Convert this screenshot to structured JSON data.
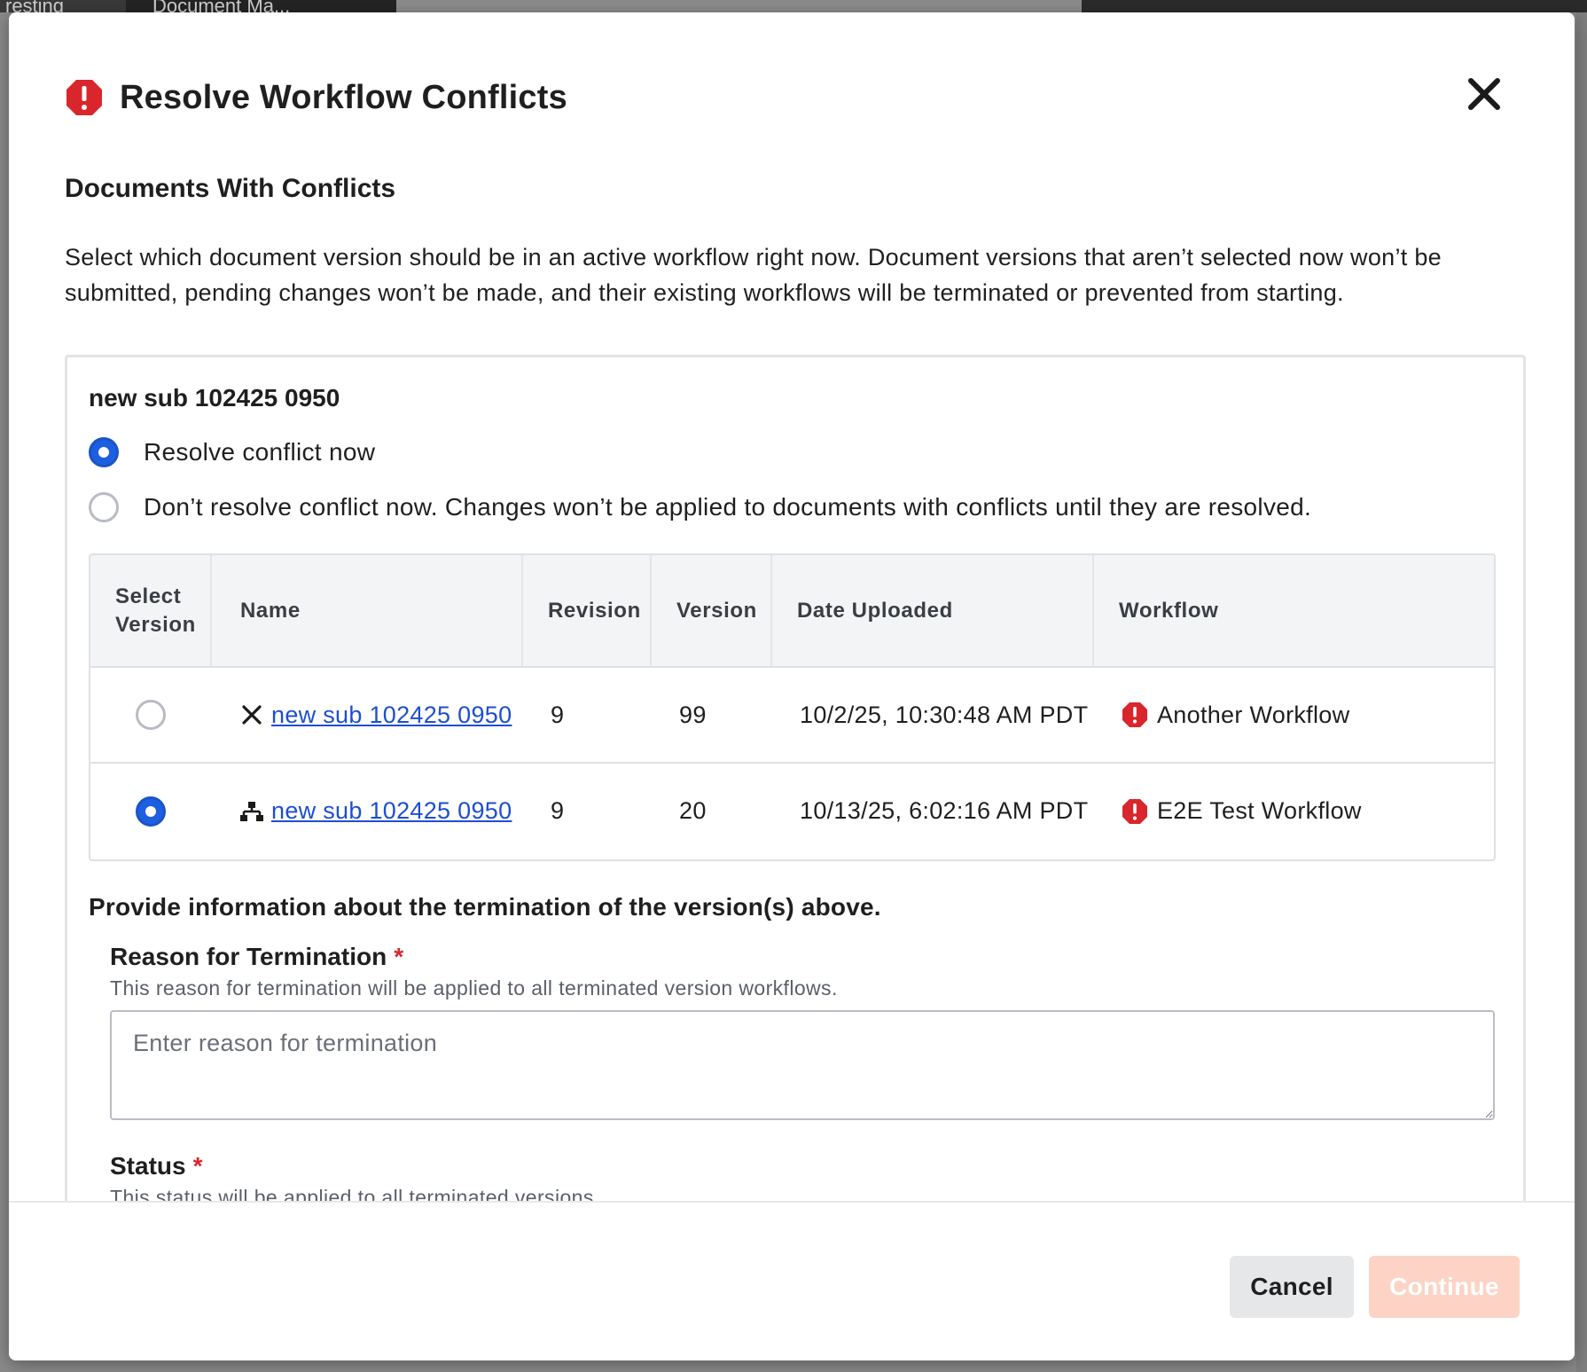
{
  "background": {
    "tabs": [
      "resting",
      "Document Ma..."
    ]
  },
  "modal": {
    "title": "Resolve Workflow Conflicts",
    "section_heading": "Documents With Conflicts",
    "description": "Select which document version should be in an active workflow right now. Document versions that aren’t selected now won’t be submitted, pending changes won’t be made, and their existing workflows will be terminated or prevented from starting.",
    "document": {
      "title": "new sub 102425 0950",
      "options": [
        {
          "label": "Resolve conflict now",
          "selected": true
        },
        {
          "label": "Don’t resolve conflict now. Changes won’t be applied to documents with conflicts until they are resolved.",
          "selected": false
        }
      ],
      "table": {
        "headers": [
          "Select Version",
          "Name",
          "Revision",
          "Version",
          "Date Uploaded",
          "Workflow"
        ],
        "rows": [
          {
            "selected": false,
            "name_icon": "x-icon",
            "name": "new sub 102425 0950",
            "revision": "9",
            "version": "99",
            "date_uploaded": "10/2/25, 10:30:48 AM PDT",
            "workflow_icon": "alert-octagon-icon",
            "workflow": "Another Workflow"
          },
          {
            "selected": true,
            "name_icon": "hierarchy-icon",
            "name": "new sub 102425 0950",
            "revision": "9",
            "version": "20",
            "date_uploaded": "10/13/25, 6:02:16 AM PDT",
            "workflow_icon": "alert-octagon-icon",
            "workflow": "E2E Test Workflow"
          }
        ]
      },
      "termination_heading": "Provide information about the termination of the version(s) above.",
      "reason": {
        "label": "Reason for Termination",
        "required_marker": "*",
        "helper": "This reason for termination will be applied to all terminated version workflows.",
        "placeholder": "Enter reason for termination",
        "value": ""
      },
      "status": {
        "label": "Status",
        "required_marker": "*",
        "helper": "This status will be applied to all terminated versions."
      }
    },
    "footer": {
      "cancel_label": "Cancel",
      "continue_label": "Continue"
    }
  },
  "colors": {
    "primary_blue": "#1e5ee0",
    "link_blue": "#1d4fd1",
    "alert_red": "#d9262c",
    "continue_disabled": "#fcd3c4",
    "cancel_bg": "#e6e7e9"
  }
}
